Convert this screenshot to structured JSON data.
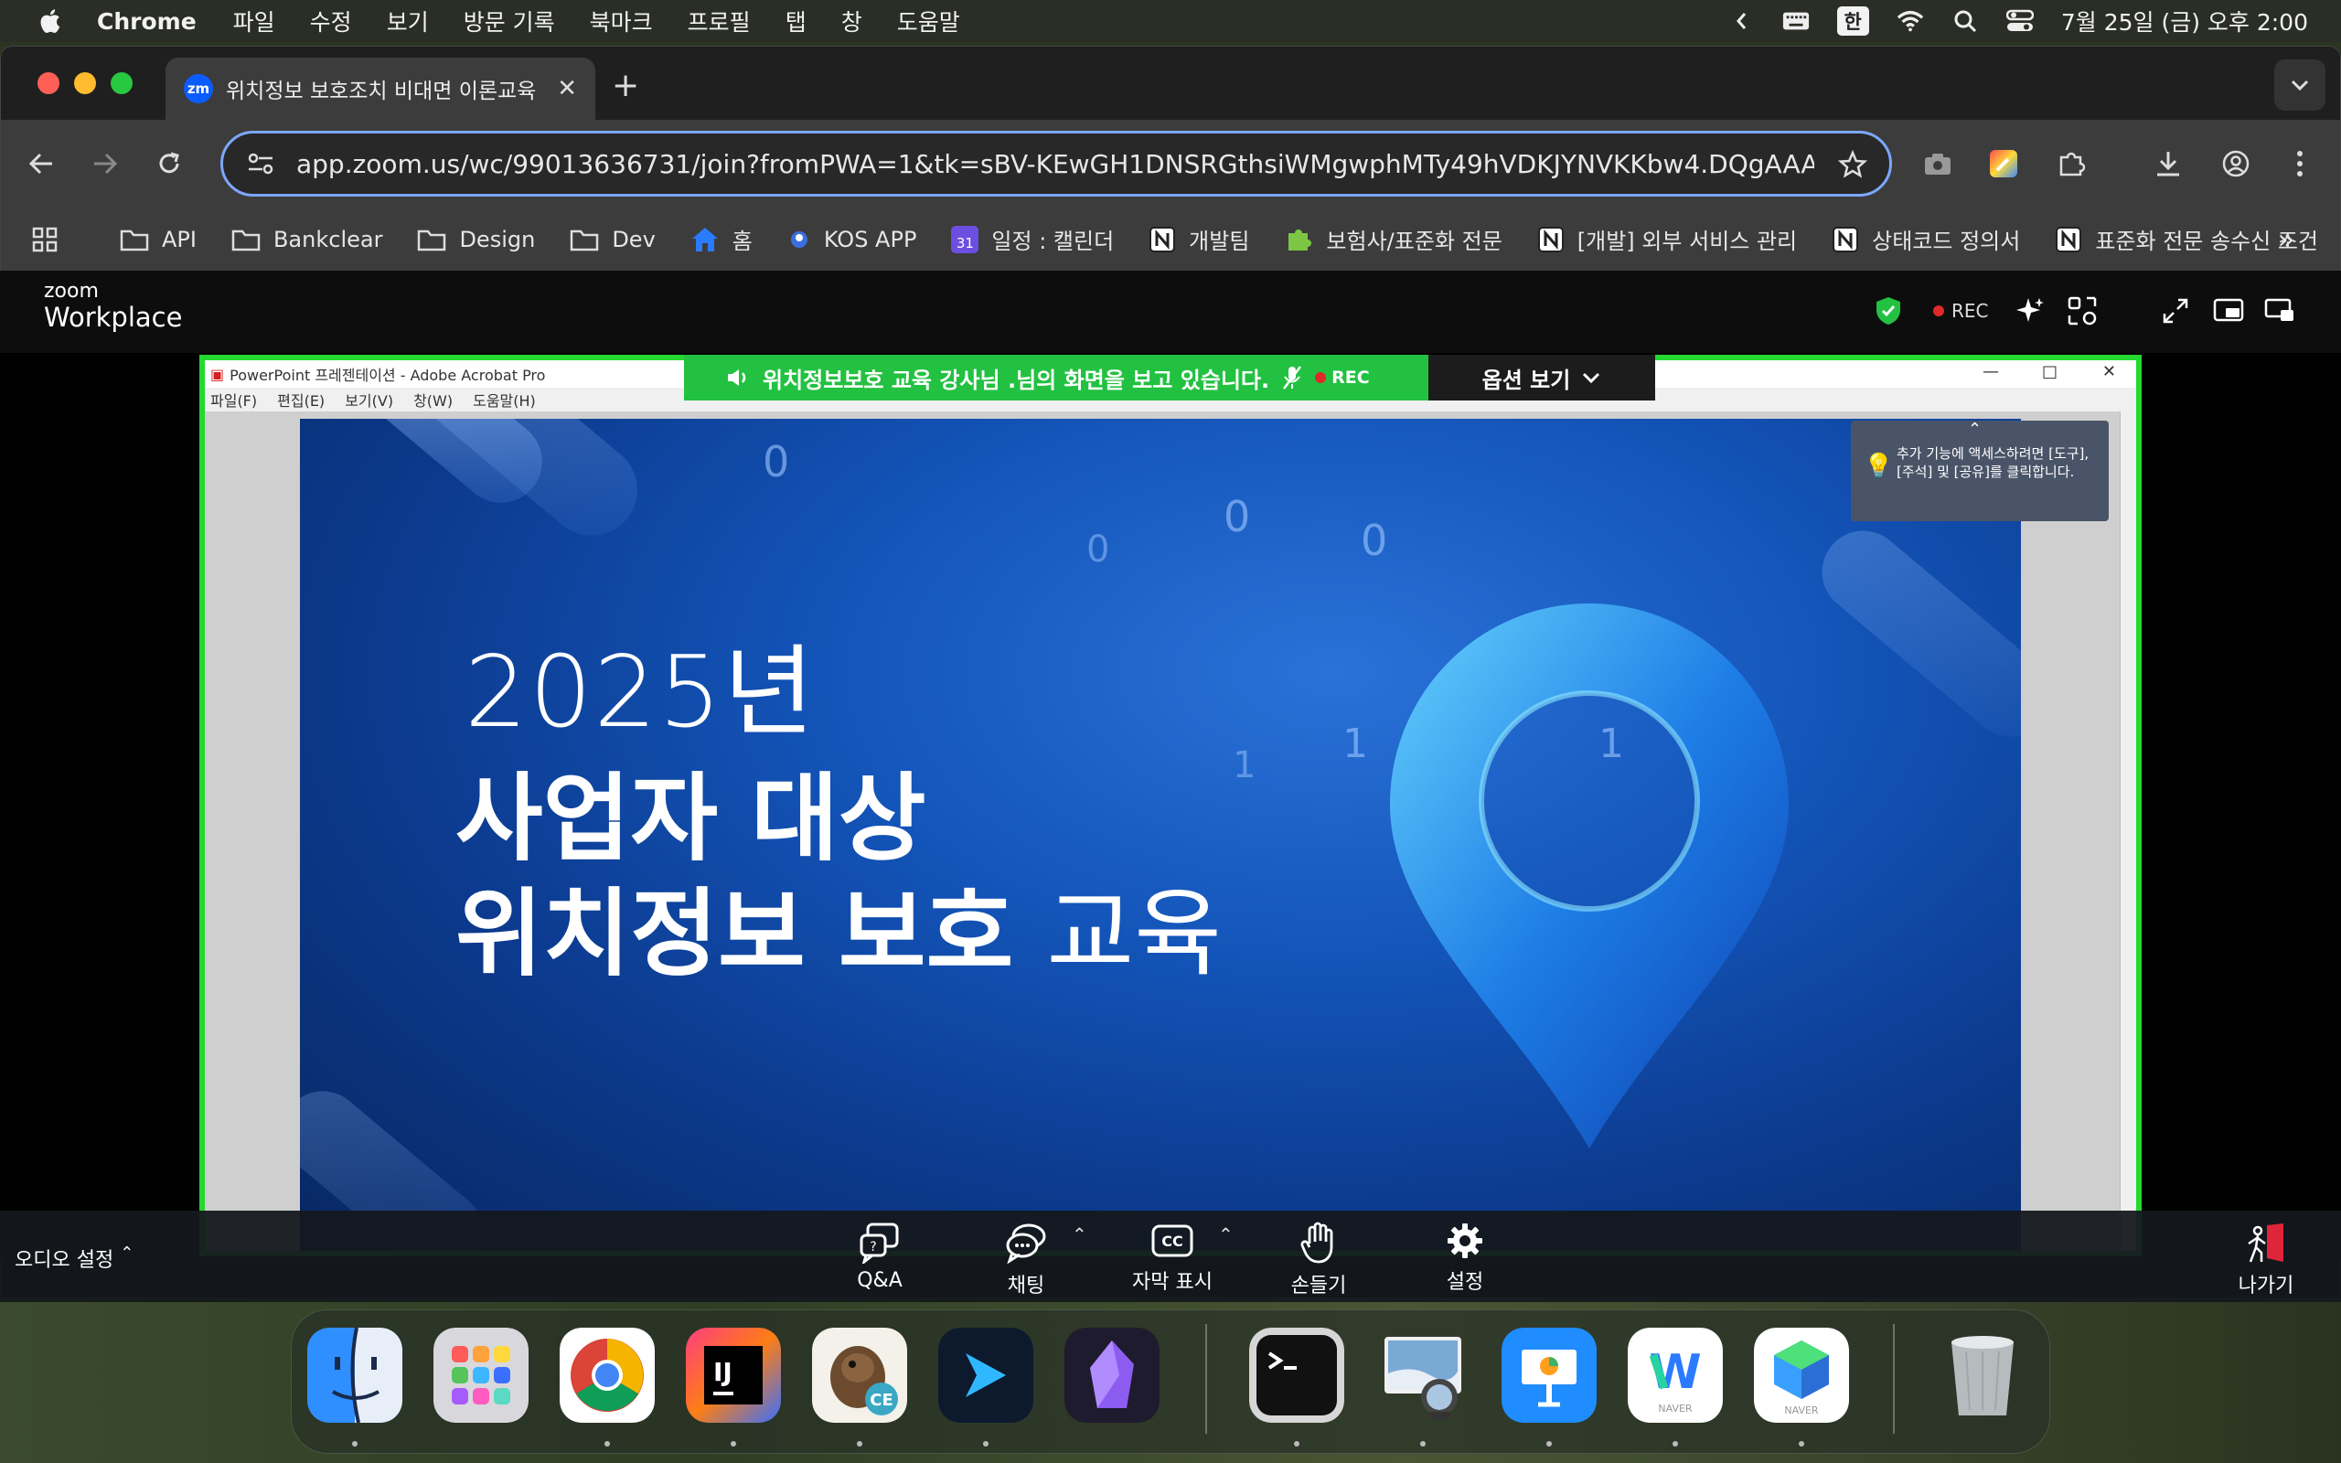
{
  "menubar": {
    "app_name": "Chrome",
    "menus": [
      "파일",
      "수정",
      "보기",
      "방문 기록",
      "북마크",
      "프로필",
      "탭",
      "창",
      "도움말"
    ],
    "input_method": "한",
    "datetime": "7월 25일 (금) 오후 2:00"
  },
  "browser": {
    "tab_title": "위치정보 보호조치 비대면 이론교육",
    "tab_favicon": "zm",
    "url": "app.zoom.us/wc/99013636731/join?fromPWA=1&tk=sBV-KEwGH1DNSRGthsiWMgwphMTy49hVDKJYNVKKbw4.DQgAAAAX...",
    "bookmarks": [
      {
        "label": "API",
        "icon": "folder-icon"
      },
      {
        "label": "Bankclear",
        "icon": "folder-icon"
      },
      {
        "label": "Design",
        "icon": "folder-icon"
      },
      {
        "label": "Dev",
        "icon": "folder-icon"
      },
      {
        "label": "홈",
        "icon": "home-icon"
      },
      {
        "label": "KOS APP",
        "icon": "app-icon"
      },
      {
        "label": "일정 : 캘린더",
        "icon": "calendar-icon"
      },
      {
        "label": "개발팀",
        "icon": "notion-icon"
      },
      {
        "label": "보험사/표준화 전문",
        "icon": "puzzle-icon"
      },
      {
        "label": "[개발] 외부 서비스 관리",
        "icon": "notion-icon"
      },
      {
        "label": "상태코드 정의서",
        "icon": "notion-icon"
      },
      {
        "label": "표준화 전문 송수신 조건",
        "icon": "notion-icon"
      }
    ],
    "calendar_badge": "31"
  },
  "zoom": {
    "logo_top": "zoom",
    "logo_bottom": "Workplace",
    "rec_label": "REC",
    "viewing_banner": "위치정보보호 교육 강사님 .님의 화면을 보고 있습니다.",
    "banner_rec": "REC",
    "options_label": "옵션 보기",
    "audio_settings": "오디오 설정",
    "footer": {
      "qa": "Q&A",
      "chat": "채팅",
      "captions": "자막 표시",
      "raise_hand": "손들기",
      "settings": "설정",
      "leave": "나가기"
    },
    "cc_label": "CC"
  },
  "acrobat": {
    "window_title": "PowerPoint 프레젠테이션 - Adobe Acrobat Pro",
    "menus": [
      "파일(F)",
      "편집(E)",
      "보기(V)",
      "창(W)",
      "도움말(H)"
    ],
    "hint": "추가 기능에 액세스하려면 [도구], [주석] 및 [공유]를 클릭합니다."
  },
  "slide": {
    "year": "2025년",
    "line2": "사업자 대상",
    "line3_bold": "위치정보 보호",
    "line3_light": "교육",
    "binary_digits": [
      "0",
      "0",
      "0",
      "1",
      "1",
      "0",
      "1"
    ]
  },
  "dock": {
    "apps": [
      "finder-icon",
      "launchpad-icon",
      "chrome-icon",
      "intellij-icon",
      "dbeaver-icon",
      "prompt-icon",
      "obsidian-icon",
      "terminal-icon",
      "preview-icon",
      "keynote-icon",
      "naver-whale-icon",
      "naver-works-icon",
      "trash-icon"
    ],
    "intellij_label": "IJ",
    "dbeaver_badge": "CE",
    "naver_label": "NAVER",
    "whale_letter": "W"
  },
  "colors": {
    "share_border": "#23d82e",
    "banner": "#23c141",
    "omnibox_border": "#7da7ff",
    "zoom_blue": "#0b5cff",
    "rec_red": "#e02828"
  }
}
